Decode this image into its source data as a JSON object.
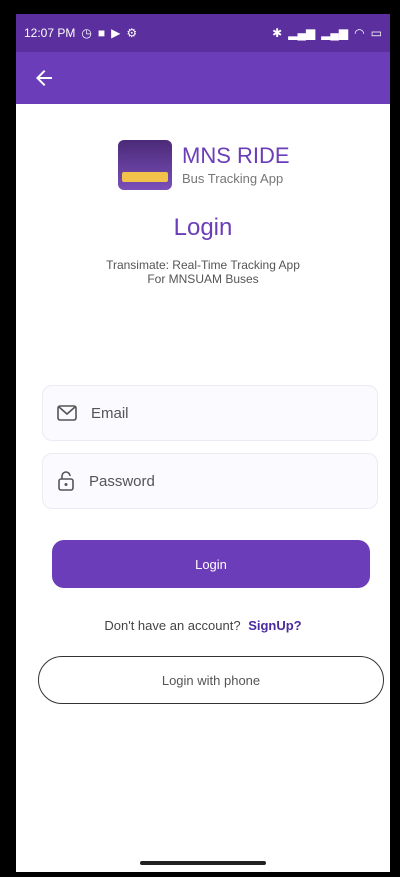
{
  "status_bar": {
    "time": "12:07 PM"
  },
  "header": {
    "back_icon": "arrow-left-icon"
  },
  "brand": {
    "name": "MNS RIDE",
    "subtitle": "Bus Tracking App",
    "logo_text": "MNS RIDE"
  },
  "login": {
    "title": "Login",
    "tagline": "Transimate: Real-Time Tracking App\nFor MNSUAM Buses",
    "email_placeholder": "Email",
    "password_placeholder": "Password",
    "login_button": "Login",
    "signup_prompt": "Don't have an account?",
    "signup_link": "SignUp?",
    "phone_button": "Login with phone"
  },
  "colors": {
    "primary": "#6b3db8",
    "primary_dark": "#5b2f9e"
  }
}
